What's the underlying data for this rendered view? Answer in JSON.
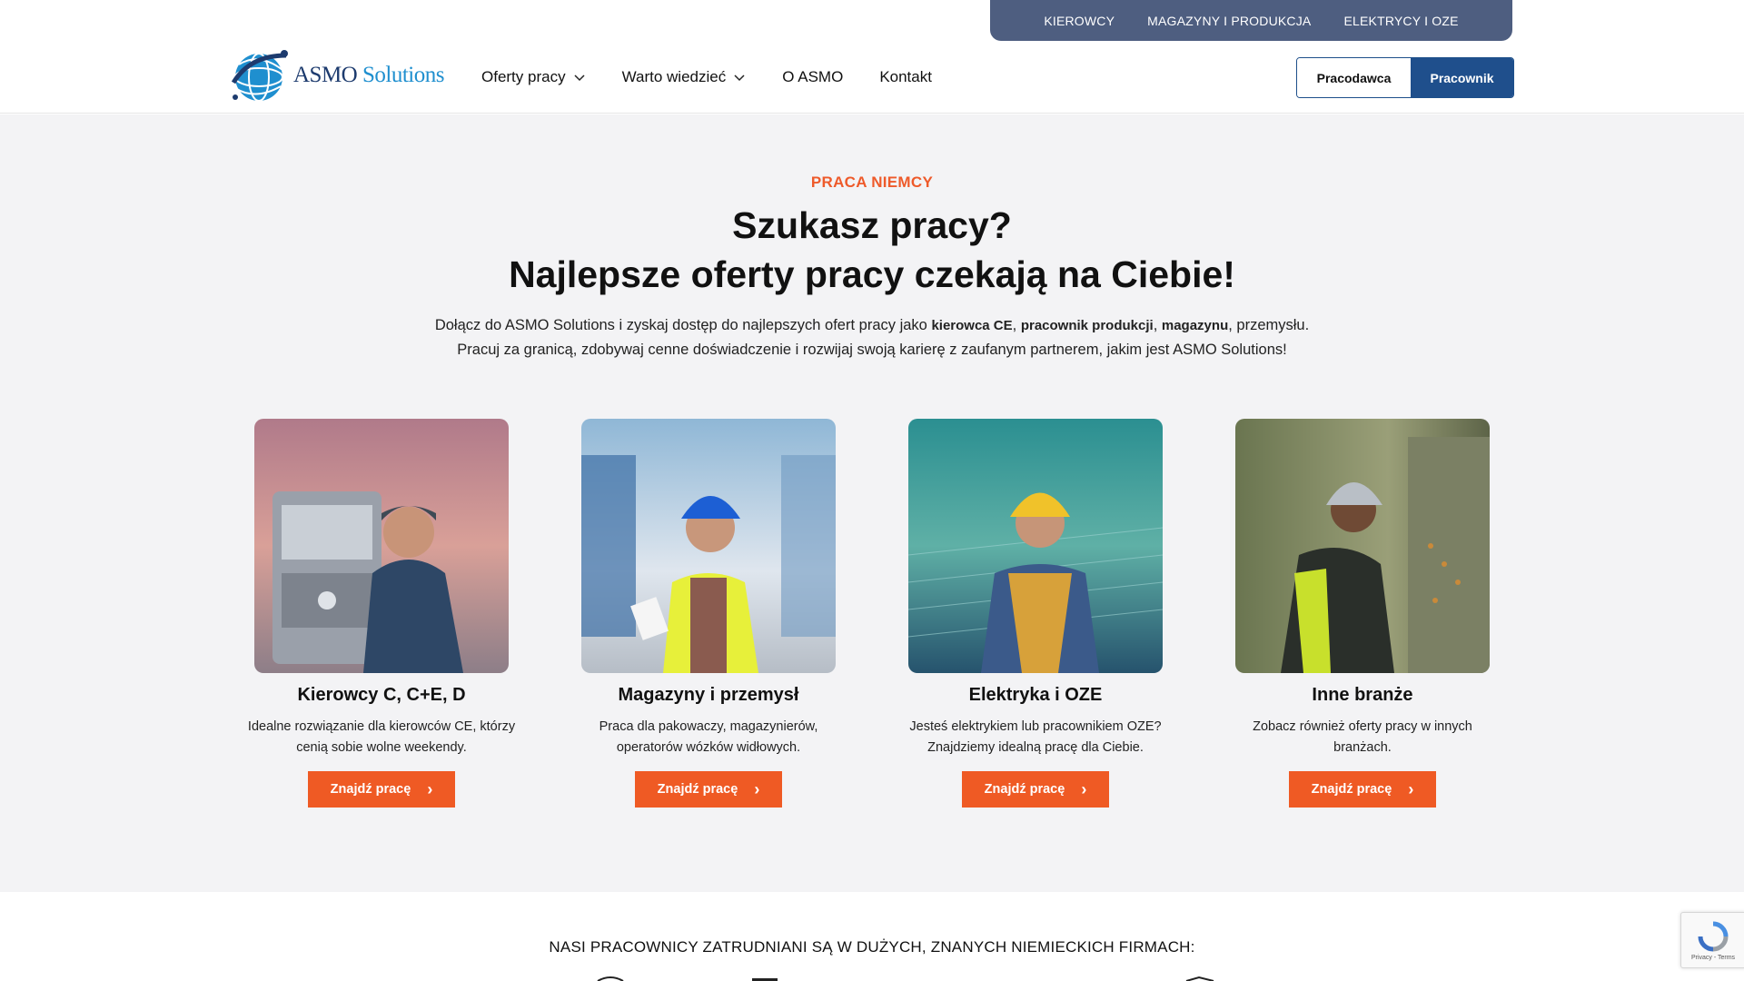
{
  "utility_nav": [
    "KIEROWCY",
    "MAGAZYNY I PRODUKCJA",
    "ELEKTRYCY I OZE"
  ],
  "logo": {
    "brand": "ASMO",
    "suffix": "Solutions"
  },
  "nav": {
    "items": [
      {
        "label": "Oferty pracy",
        "has_dropdown": true
      },
      {
        "label": "Warto wiedzieć",
        "has_dropdown": true
      },
      {
        "label": "O ASMO",
        "has_dropdown": false
      },
      {
        "label": "Kontakt",
        "has_dropdown": false
      }
    ]
  },
  "roles": {
    "employer": "Pracodawca",
    "employee": "Pracownik",
    "active": "employee"
  },
  "hero": {
    "eyebrow": "PRACA NIEMCY",
    "headline_1": "Szukasz pracy?",
    "headline_2": "Najlepsze oferty pracy czekają na Ciebie!",
    "lead_1a": "Dołącz do ASMO Solutions i zyskaj dostęp do najlepszych ofert pracy jako ",
    "lead_1b": "kierowca CE",
    "lead_1c": ", ",
    "lead_1d": "pracownik produkcji",
    "lead_1e": ", ",
    "lead_1f": "magazynu",
    "lead_1g": ", przemysłu.",
    "lead_2": "Pracuj za granicą, zdobywaj cenne doświadczenie i rozwijaj swoją karierę z zaufanym partnerem, jakim jest ASMO Solutions!"
  },
  "cards": [
    {
      "title": "Kierowcy C, C+E, D",
      "desc": "Idealne rozwiązanie dla kierowców CE, którzy cenią sobie wolne weekendy.",
      "button": "Znajdź pracę"
    },
    {
      "title": "Magazyny i przemysł",
      "desc": "Praca dla pakowaczy, magazynierów, operatorów wózków widłowych.",
      "button": "Znajdź pracę"
    },
    {
      "title": "Elektryka i OZE",
      "desc": "Jesteś elektrykiem lub pracownikiem OZE? Znajdziemy idealną pracę dla Ciebie.",
      "button": "Znajdź pracę"
    },
    {
      "title": "Inne branże",
      "desc": "Zobacz również oferty pracy w innych branżach.",
      "button": "Znajdź pracę"
    }
  ],
  "clients_heading": "NASI PRACOWNICY ZATRUDNIANI SĄ W DUŻYCH, ZNANYCH NIEMIECKICH FIRMACH:",
  "recaptcha": {
    "text": "Privacy - Terms"
  },
  "colors": {
    "accent": "#ef5a24",
    "primary": "#1f4f8c",
    "utility_bar": "#4e5e80",
    "hero_bg": "#f3f3f5"
  }
}
